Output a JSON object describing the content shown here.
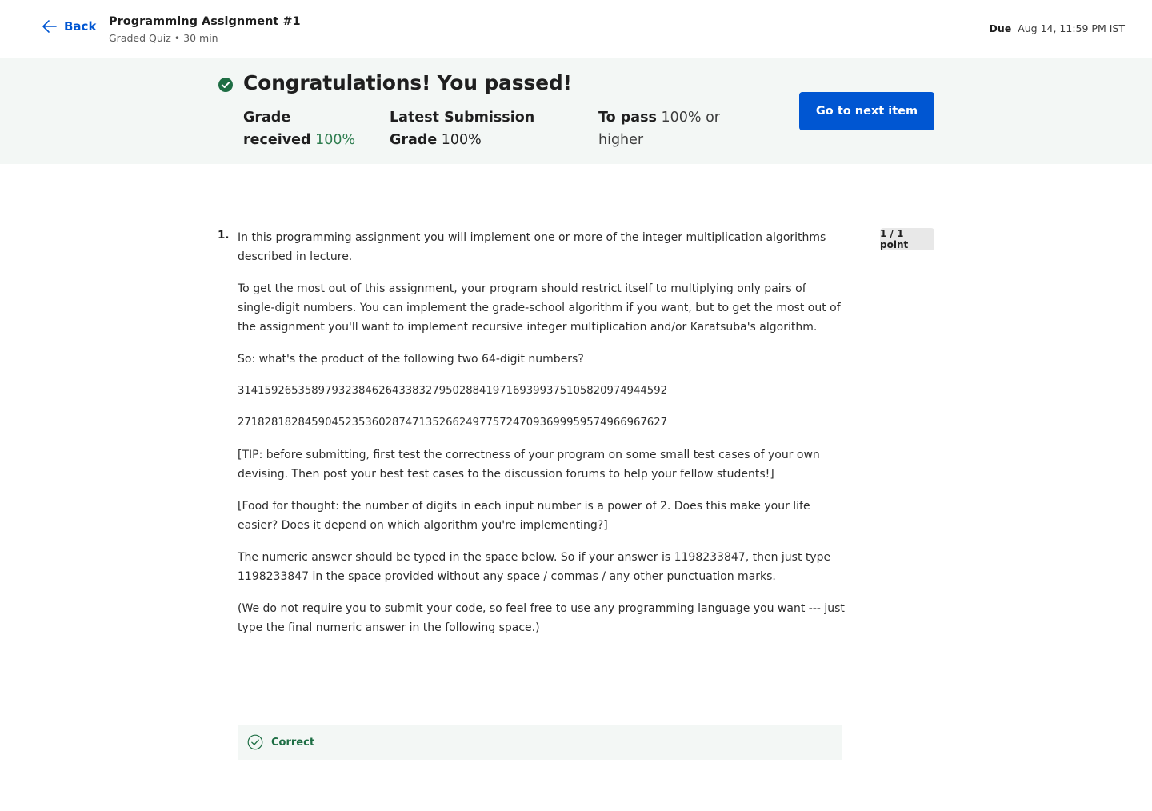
{
  "header": {
    "back_label": "Back",
    "title": "Programming Assignment #1",
    "subtitle": "Graded Quiz • 30 min",
    "due_label": "Due",
    "due_value": "Aug 14, 11:59 PM IST"
  },
  "banner": {
    "headline": "Congratulations! You passed!",
    "grade_label_1": "Grade",
    "grade_label_2": "received",
    "grade_value": "100%",
    "latest_label_1": "Latest Submission",
    "latest_label_2": "Grade",
    "latest_value": "100%",
    "pass_label": "To pass",
    "pass_value_1": "100% or",
    "pass_value_2": "higher",
    "next_button": "Go to next item",
    "colors": {
      "accent": "#0056d2",
      "success": "#2e7d4f",
      "banner_bg": "#f3f7f5"
    }
  },
  "question": {
    "number": "1.",
    "points": "1 / 1 point",
    "paragraphs": [
      "In this programming assignment you will implement one or more of the integer multiplication algorithms described in lecture.",
      "To get the most out of this assignment, your program should restrict itself to multiplying only pairs of single-digit numbers.  You can implement the grade-school algorithm if you want, but to get the most out of the assignment you'll want to implement recursive integer multiplication and/or Karatsuba's algorithm.",
      "So: what's the product of the following two 64-digit numbers?",
      "3141592653589793238462643383279502884197169399375105820974944592",
      "2718281828459045235360287471352662497757247093699959574966967627",
      "[TIP: before submitting, first test the correctness of your program on some small test cases of your own devising. Then post your best test cases to the discussion forums to help your fellow students!]",
      "[Food for thought: the number of digits in each input number is a power of 2.  Does this make your life easier? Does it depend on which algorithm you're implementing?]",
      "The numeric answer should be typed in the space below.  So if your answer is 1198233847, then just type 1198233847 in the space provided without any space / commas / any other punctuation marks.",
      "(We do not require you to submit your code, so feel free to use any programming language you want --- just type the final numeric answer in the following space.)"
    ]
  },
  "feedback": {
    "label": "Correct",
    "icon": "check-circle-icon"
  }
}
